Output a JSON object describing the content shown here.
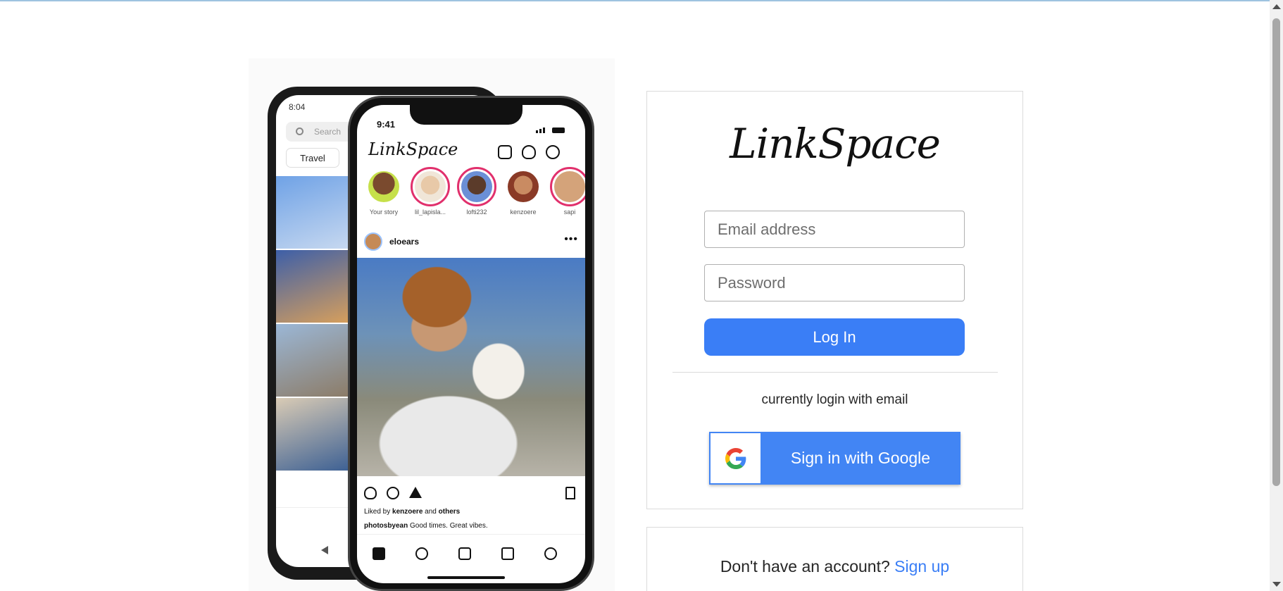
{
  "brand": {
    "logo_text": "LinkSpace"
  },
  "illustration": {
    "back_phone": {
      "time": "8:04",
      "search_placeholder": "Search",
      "chip": "Travel"
    },
    "front_phone": {
      "time": "9:41",
      "app_logo": "LinkSpace",
      "stories": [
        {
          "name": "Your story"
        },
        {
          "name": "lil_lapisla..."
        },
        {
          "name": "lofti232"
        },
        {
          "name": "kenzoere"
        },
        {
          "name": "sapi"
        }
      ],
      "post_user": "eloears",
      "liked_by_prefix": "Liked by ",
      "liked_by_user": "kenzoere",
      "liked_by_and": " and ",
      "liked_by_others": "others",
      "caption_user": "photosbyean",
      "caption_text": " Good times. Great vibes."
    }
  },
  "login": {
    "email_placeholder": "Email address",
    "password_placeholder": "Password",
    "login_label": "Log In",
    "note": "currently login with email",
    "google_label": "Sign in with Google"
  },
  "signup": {
    "prompt": "Don't have an account? ",
    "link_label": "Sign up"
  },
  "colors": {
    "primary": "#3a7ef6",
    "google_blue": "#4285f4",
    "border": "#dbdbdb"
  }
}
